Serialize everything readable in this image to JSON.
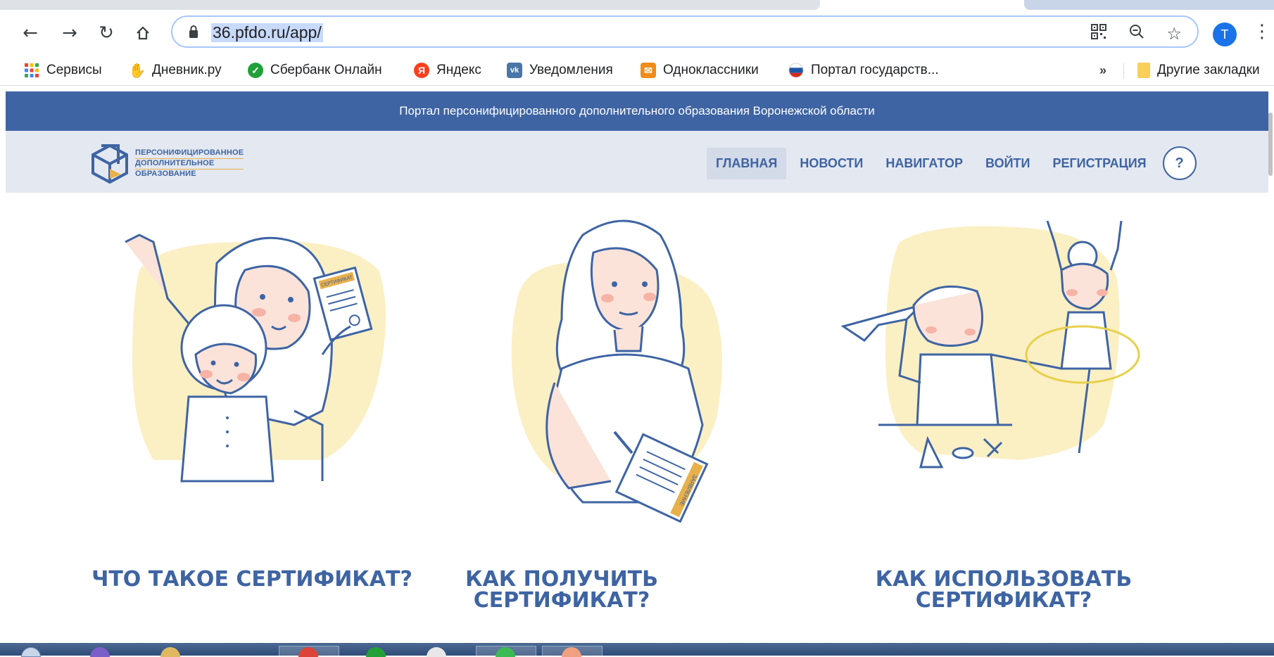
{
  "browser": {
    "url": "36.pfdo.ru/app/",
    "profile_initial": "T",
    "icons": [
      "back-arrow-icon",
      "forward-arrow-icon",
      "reload-icon",
      "home-icon",
      "lock-icon",
      "qr-code-icon",
      "zoom-icon",
      "star-icon",
      "menu-kebab-icon"
    ]
  },
  "bookmarks": {
    "items": [
      {
        "label": "Сервисы",
        "icon": "apps-grid-icon"
      },
      {
        "label": "Дневник.ру",
        "icon": "hand-icon"
      },
      {
        "label": "Сбербанк Онлайн",
        "icon": "sberbank-icon"
      },
      {
        "label": "Яндекс",
        "icon": "yandex-icon"
      },
      {
        "label": "Уведомления",
        "icon": "vk-icon"
      },
      {
        "label": "Одноклассники",
        "icon": "mail-icon"
      },
      {
        "label": "Портал государств...",
        "icon": "russia-flag-icon"
      }
    ],
    "more": "»",
    "other_label": "Другие закладки"
  },
  "site": {
    "banner": "Портал персонифицированного дополнительного образования Воронежской области",
    "logo": [
      "ПЕРСОНИФИЦИРОВАННОЕ",
      "ДОПОЛНИТЕЛЬНОЕ",
      "ОБРАЗОВАНИЕ"
    ],
    "nav": [
      "ГЛАВНАЯ",
      "НОВОСТИ",
      "НАВИГАТОР",
      "ВОЙТИ",
      "РЕГИСТРАЦИЯ"
    ],
    "help": "?",
    "colors": {
      "brand": "#3e64a3",
      "accent": "#e8b04a",
      "blob": "#fbefc4"
    }
  },
  "cards": [
    {
      "title_lines": [
        "ЧТО ТАКОЕ СЕРТИФИКАТ?"
      ],
      "certificate_text": "СЕРТИФИКАТ"
    },
    {
      "title_lines": [
        "КАК ПОЛУЧИТЬ",
        "СЕРТИФИКАТ?"
      ],
      "document_text": "ЗАЯВЛЕНИЕ"
    },
    {
      "title_lines": [
        "КАК ИСПОЛЬЗОВАТЬ",
        "СЕРТИФИКАТ?"
      ]
    }
  ]
}
